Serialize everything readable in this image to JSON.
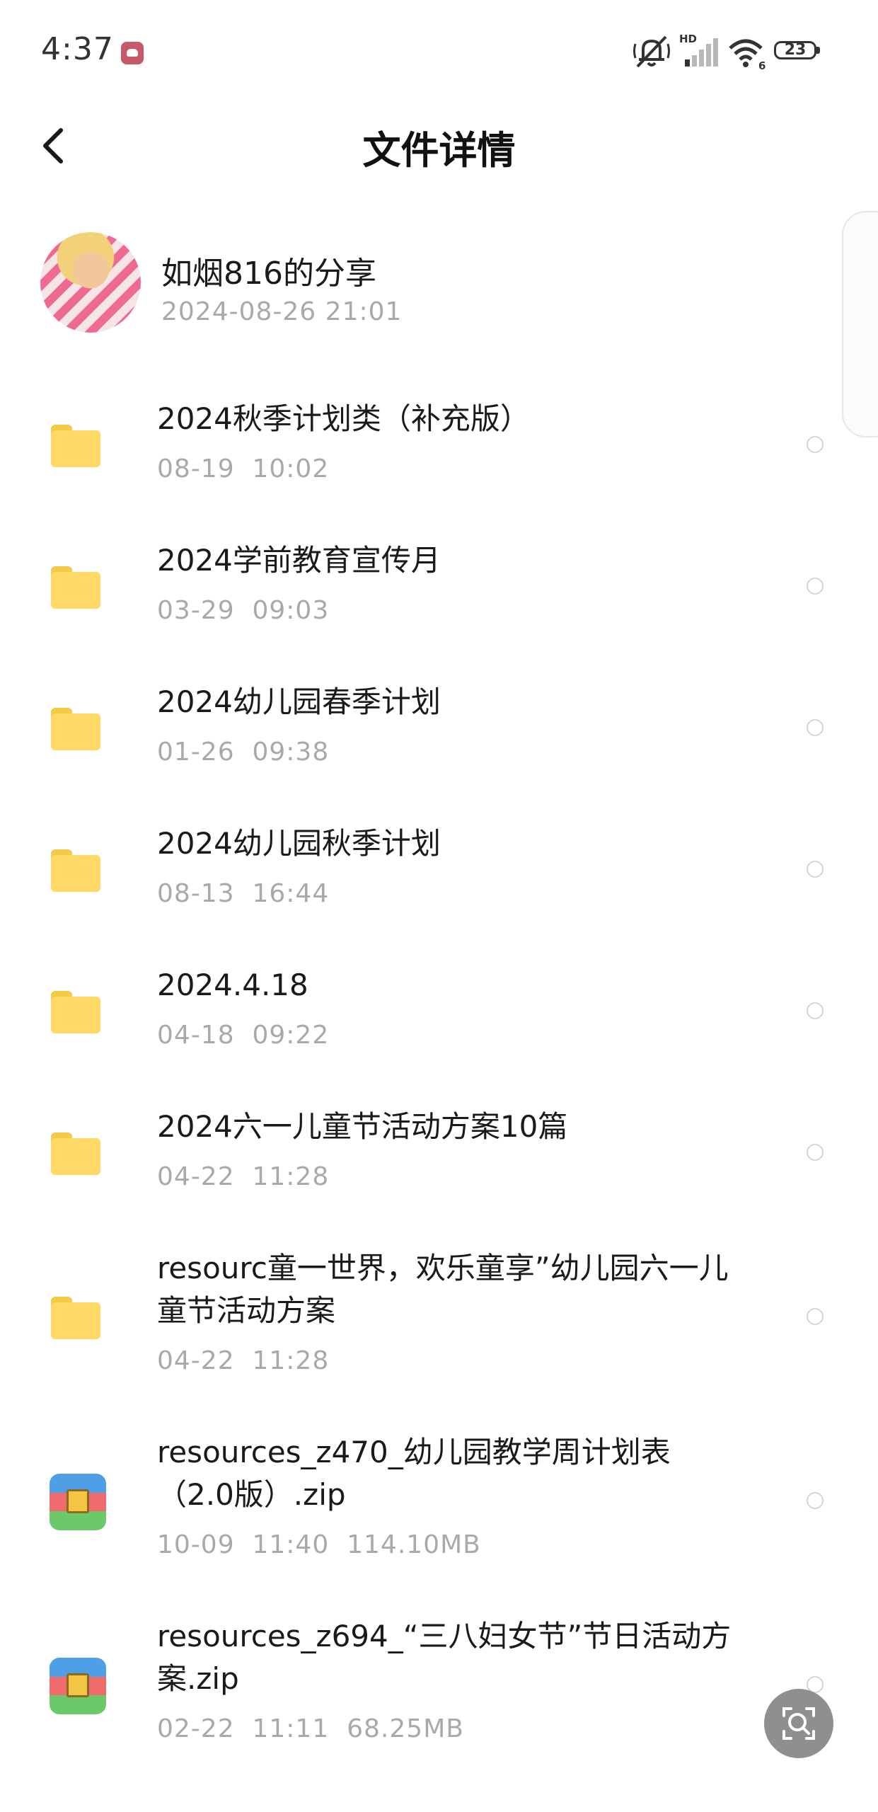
{
  "status_bar": {
    "time": "4:37",
    "signal_label": "HD",
    "wifi_label": "6",
    "battery_level": "23"
  },
  "header": {
    "title": "文件详情"
  },
  "sharer": {
    "name": "如烟816的分享",
    "timestamp": "2024-08-26  21:01"
  },
  "files": [
    {
      "type": "folder",
      "name": "2024秋季计划类（补充版）",
      "meta": "08-19  10:02"
    },
    {
      "type": "folder",
      "name": "2024学前教育宣传月",
      "meta": "03-29  09:03"
    },
    {
      "type": "folder",
      "name": "2024幼儿园春季计划",
      "meta": "01-26  09:38"
    },
    {
      "type": "folder",
      "name": "2024幼儿园秋季计划",
      "meta": "08-13  16:44"
    },
    {
      "type": "folder",
      "name": "2024.4.18",
      "meta": "04-18  09:22"
    },
    {
      "type": "folder",
      "name": "2024六一儿童节活动方案10篇",
      "meta": "04-22  11:28"
    },
    {
      "type": "folder",
      "name": "resourc童一世界，欢乐童享”幼儿园六一儿童节活动方案",
      "meta": "04-22  11:28"
    },
    {
      "type": "zip",
      "name": "resources_z470_幼儿园教学周计划表（2.0版）.zip",
      "meta": "10-09  11:40  114.10MB"
    },
    {
      "type": "zip",
      "name": "resources_z694_“三八妇女节”节日活动方案.zip",
      "meta": "02-22  11:11  68.25MB"
    }
  ],
  "icons": {
    "back": "chevron-left-icon",
    "folder": "folder-icon",
    "zip": "archive-zip-icon",
    "lens": "image-search-icon"
  },
  "colors": {
    "folder": "#ffd865",
    "secondary_text": "#a9a9a9",
    "fab": "#8f8f8f"
  }
}
